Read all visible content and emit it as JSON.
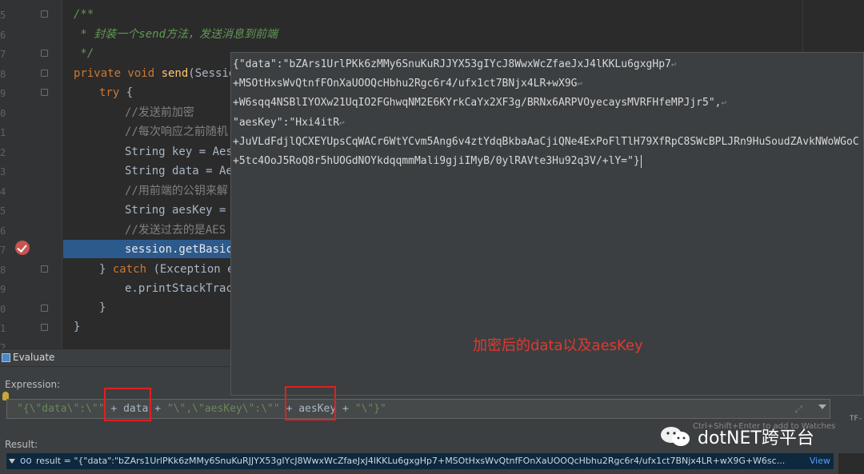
{
  "editor": {
    "line_numbers": [
      "5",
      "6",
      "7",
      "8",
      "9",
      "0",
      "1",
      "2",
      "3",
      "4",
      "5",
      "6",
      "7",
      "8",
      "9",
      "0",
      "1",
      "2"
    ],
    "lines": [
      {
        "text": "/**"
      },
      {
        "text": " * 封装一个send方法，发送消息到前端"
      },
      {
        "text": " */"
      },
      {
        "kw": "private void ",
        "fn": "send",
        "rest": "(Session"
      },
      {
        "kw": "try",
        "rest": " {"
      },
      {
        "text": "//发送前加密"
      },
      {
        "text": "//每次响应之前随机"
      },
      {
        "text": "String key = AesU"
      },
      {
        "text": "String data = Aes"
      },
      {
        "text": "//用前端的公钥来解"
      },
      {
        "text": "String aesKey = E"
      },
      {
        "text": "//发送过去的是AES"
      },
      {
        "text": "session.getBasicR"
      },
      {
        "text": "} ",
        "kw": "catch",
        "rest": " (Exception e)"
      },
      {
        "text": "e.printStackTrace"
      },
      {
        "text": "}"
      },
      {
        "text": "}"
      }
    ]
  },
  "popup": {
    "lines": [
      "{\"data\":\"bZArs1UrlPKk6zMMy6SnuKuRJJYX53gIYcJ8WwxWcZfaeJxJ4lKKLu6gxgHp7",
      "+MSOtHxsWvQtnfFOnXaUOOQcHbhu2Rgc6r4/ufx1ct7BNjx4LR+wX9G",
      "+W6sqq4NSBlIYOXw21UqIO2FGhwqNM2E6KYrkCaYx2XF3g/BRNx6ARPVOyecaysMVRFHfeMPJjr5\",",
      "\"aesKey\":\"Hxi4itR",
      "+JuVLdFdjlQCXEYUpsCqWACr6WtYCvm5Ang6v4ztYdqBkbaAaCjiQNe4ExPoFlTlH79XfRpC8SWcBPLJRn9HuSoudZAvkNWoWGoC",
      "+5tc4OoJ5RoQ8r5hUOGdNOYkdqqmmMali9gjiIMyB/0ylRAVte3Hu92q3V/+lY=\"}"
    ],
    "wrap_marks": [
      "↩",
      "↩",
      "↩",
      "↩"
    ],
    "annotation": "加密后的data以及aesKey"
  },
  "evaluate": {
    "title": "Evaluate",
    "expression_label": "Expression:",
    "expr": {
      "s1": "\"{\\\"data\\\":\\\"\"",
      "op1": " + ",
      "v1": "data",
      "op2": " + ",
      "s2": "\"\\\",\\\"aesKey\\\":\\\"\"",
      "op3": " + ",
      "v2": "aesKey",
      "op4": " + ",
      "s3": "\"\\\"}\""
    },
    "result_label": "Result:",
    "result_oo": "oo",
    "result_text": "result = \"{\"data\":\"bZArs1UrlPKk6zMMy6SnuKuRJJYX53gIYcJ8WwxWcZfaeJxJ4lKKLu6gxgHp7+MSOtHxsWvQtnfFOnXaUOOQcHbhu2Rgc6r4/ufx1ct7BNjx4LR+wX9G+W6sc...",
    "view_link": "View",
    "hint": "Ctrl+Shift+Enter to add to Watches",
    "tf_tag": "TF-"
  },
  "watermark": {
    "text": "dotNET跨平台"
  },
  "colors": {
    "comment": "#629755",
    "keyword": "#cc7832",
    "method": "#ffc66d",
    "highlight": "#e02020",
    "exec_line": "#2d5a8c"
  }
}
